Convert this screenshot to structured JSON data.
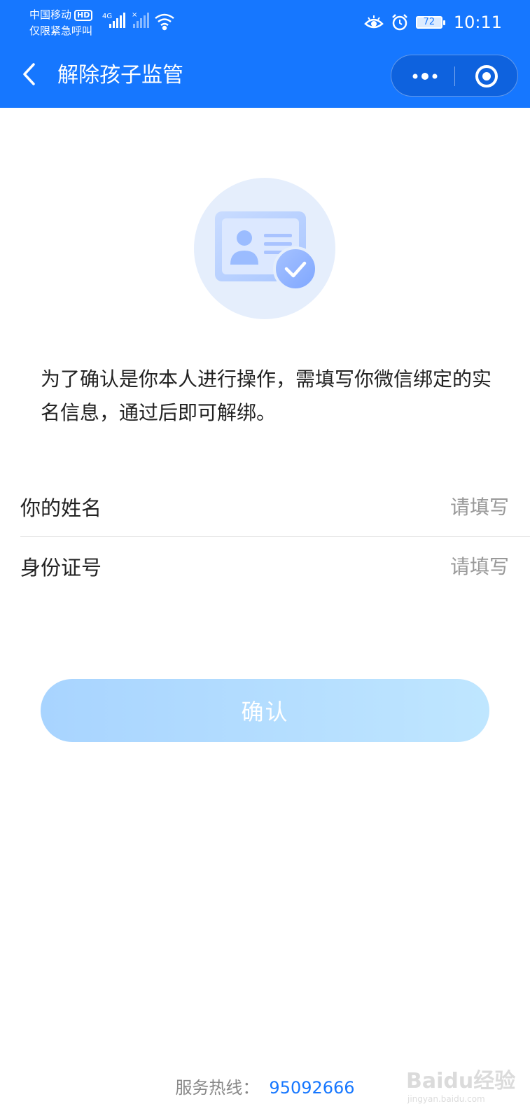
{
  "status_bar": {
    "carrier": "中国移动",
    "hd": "HD",
    "emergency": "仅限紧急呼叫",
    "network": "4G",
    "battery": "72",
    "time": "10:11"
  },
  "nav": {
    "title": "解除孩子监管",
    "back_icon": "chevron-left-icon",
    "more_icon": "more-dots-icon",
    "close_icon": "target-circle-icon"
  },
  "hero": {
    "icon": "id-card-verified-icon"
  },
  "intro_text": "为了确认是你本人进行操作，需填写你微信绑定的实名信息，通过后即可解绑。",
  "form": {
    "name_label": "你的姓名",
    "name_placeholder": "请填写",
    "id_label": "身份证号",
    "id_placeholder": "请填写"
  },
  "confirm_label": "确认",
  "footer": {
    "hotline_label": "服务热线：",
    "hotline_number": "95092666"
  },
  "watermark": {
    "text": "Baidu经验",
    "url": "jingyan.baidu.com"
  },
  "colors": {
    "brand": "#1677ff",
    "button": "#b6dcff"
  }
}
